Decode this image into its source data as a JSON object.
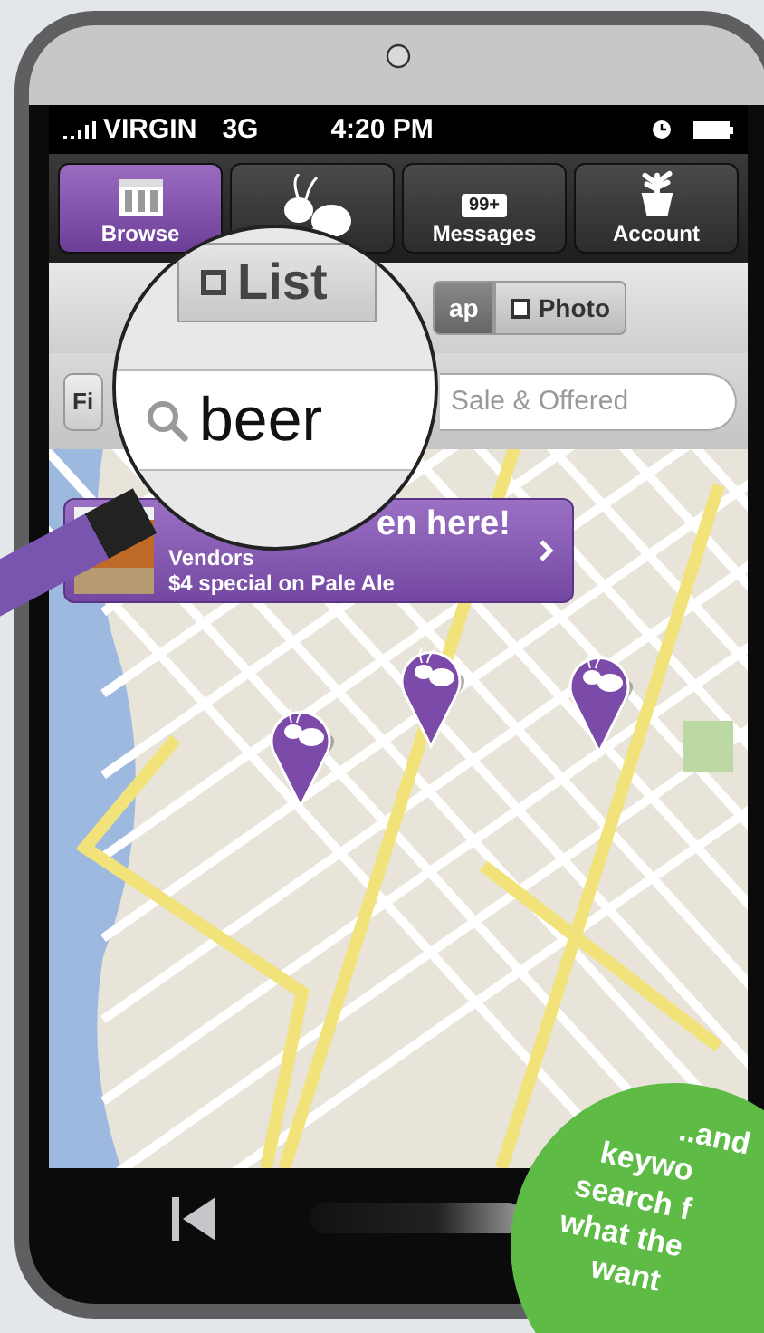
{
  "status_bar": {
    "carrier": "VIRGIN",
    "network": "3G",
    "time": "4:20 PM"
  },
  "tabs": [
    {
      "kind": "browse",
      "label": "Browse",
      "selected": true
    },
    {
      "kind": "ant",
      "selected": false
    },
    {
      "kind": "messages",
      "label": "Messages",
      "badge": "99+",
      "selected": false
    },
    {
      "kind": "account",
      "label": "Account",
      "selected": false
    }
  ],
  "view_toggle": [
    {
      "label": "ap",
      "selected": true
    },
    {
      "label": "Photo",
      "selected": false
    }
  ],
  "filter_button": "Fi",
  "search": {
    "placeholder": "Sale & Offered"
  },
  "magnifier": {
    "tab": "List",
    "query": "beer"
  },
  "banner": {
    "title_end": "en here!",
    "category": "Vendors",
    "offer": "$4 special on Pale Ale"
  },
  "callout": {
    "lines": [
      "..and",
      "keywo",
      "search f",
      "what the",
      "want"
    ]
  }
}
